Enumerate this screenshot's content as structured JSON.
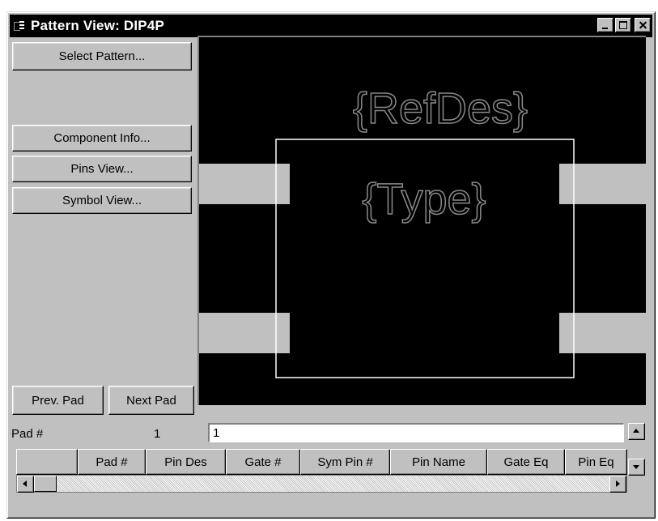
{
  "window": {
    "title": "Pattern View: DIP4P"
  },
  "buttons": {
    "select_pattern": "Select Pattern...",
    "component_info": "Component Info...",
    "pins_view": "Pins View...",
    "symbol_view": "Symbol View...",
    "prev_pad": "Prev. Pad",
    "next_pad": "Next Pad"
  },
  "canvas": {
    "refdes_text": "{RefDes}",
    "type_text": "{Type}",
    "background": "#000000",
    "pad_color": "#c0c0c0",
    "outline_color": "#ffffff",
    "text_color": "#808080"
  },
  "pad_grid": {
    "pad_label": "Pad #",
    "pad_number": "1",
    "pad_input_value": "1",
    "columns": [
      "",
      "Pad #",
      "Pin Des",
      "Gate #",
      "Sym Pin #",
      "Pin Name",
      "Gate Eq",
      "Pin Eq"
    ]
  }
}
